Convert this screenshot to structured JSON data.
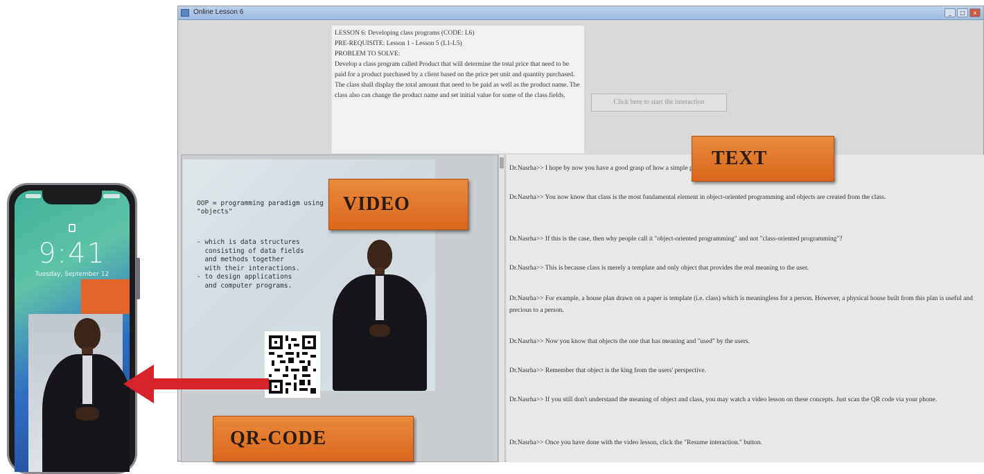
{
  "window": {
    "title": "Online Lesson 6",
    "controls": {
      "minimize": "_",
      "maximize": "□",
      "close": "x"
    }
  },
  "lesson": {
    "line1": "LESSON 6:  Developing class programs (CODE: L6)",
    "line2": "PRE-REQUISITE:  Lesson 1 - Lesson 5 (L1-L5)",
    "line3": "PROBLEM TO SOLVE:",
    "description": "Develop a class program called Product that will determine the total price that need to be paid for a product purchased by a client based on the price per unit and quantity purchased. The class shall display the total amount that need to be paid as well as the product name. The class also can change the product name and set initial value for some of the class fields."
  },
  "start_button": {
    "label": "Click here to start the interaction"
  },
  "video": {
    "slide_heading": "OOP = programming paradigm using \"objects\"",
    "slide_bullets": [
      "- which is data structures",
      "  consisting of data fields",
      "  and methods together",
      "  with their interactions.",
      "- to design applications",
      "  and computer programs."
    ]
  },
  "phone": {
    "time": "9:41",
    "date": "Tuesday, September 12"
  },
  "chat": [
    "Dr.Nasrha>> I hope by now you have a good grasp of how a simple program can be written in Java.",
    "Dr.Nasrha>> You now know that class is the most fundamental element in object-oriented programming and objects are created from the class.",
    "Dr.Nasrha>> If this is the case, then why people call it \"object-oriented programming\" and not \"class-oriented programming\"?",
    "Dr.Nasrha>> This is because class is merely a template and only object that provides the real meaning to the user.",
    "Dr.Nasrha>> For example, a house plan drawn on a paper is template (i.e. class) which is meaningless for a person. However, a physical house built from this plan is useful and precious to a person.",
    "Dr.Nasrha>> Now you know that objects the one that has meaning and \"used\" by the users.",
    "Dr.Nasrha>> Remember that object is the king from the users' perspective.",
    "Dr.Nasrha>> If you still don't understand the meaning of object and class, you may watch a video lesson on these concepts. Just scan the QR code via your phone.",
    "Dr.Nasrha>> Once you have done with the video lesson, click the \"Resume interaction.\" button."
  ],
  "labels": {
    "text": "TEXT",
    "video": "VIDEO",
    "qr": "QR-CODE"
  },
  "colors": {
    "label_orange": "#e07527",
    "arrow_red": "#d8232a",
    "window_bg": "#d9d9d9",
    "titlebar": "#a9c3e4"
  }
}
